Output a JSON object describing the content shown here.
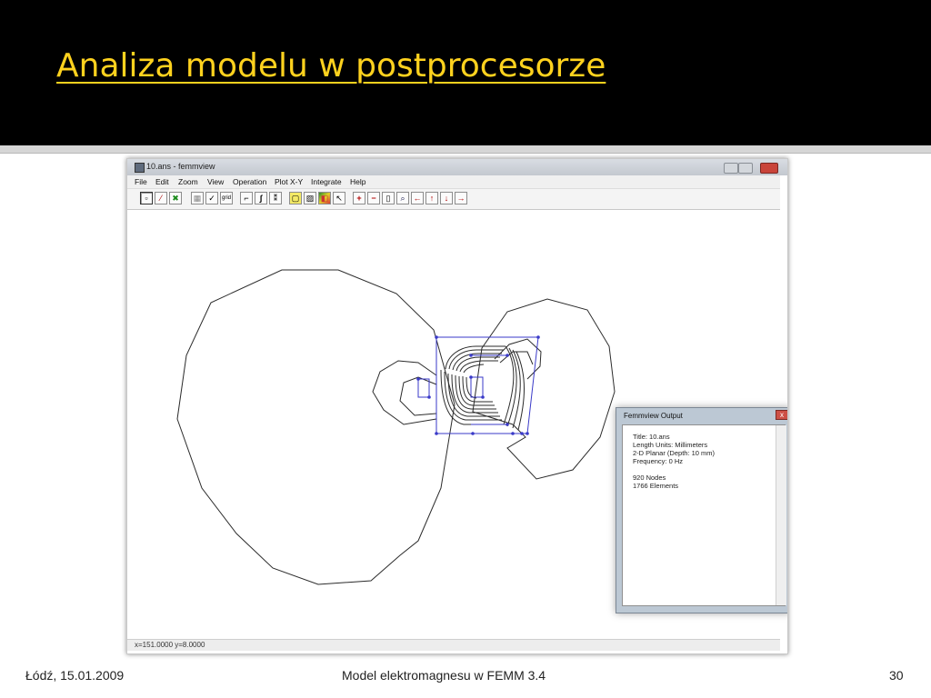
{
  "slide": {
    "title": "Analiza modelu w postprocesorze",
    "footer_left": "Łódź, 15.01.2009",
    "footer_center": "Model elektromagnesu w FEMM 3.4",
    "page_number": "30"
  },
  "app": {
    "window_title": "10.ans - femmview",
    "menu": [
      "File",
      "Edit",
      "Zoom",
      "View",
      "Operation",
      "Plot X-Y",
      "Integrate",
      "Help"
    ],
    "toolbar_glyphs": [
      "▫",
      "⁄",
      "✖",
      "▦",
      "✓",
      "grid",
      "⌐",
      "∫",
      "⁑",
      "▢",
      "▨",
      "◧",
      "↖",
      "+",
      "−",
      "▯",
      "⌕",
      "←",
      "↑",
      "↓",
      "→"
    ],
    "status_text": "x=151.0000 y=8.0000"
  },
  "output_window": {
    "title": "Femmview Output",
    "close_glyph": "x",
    "lines": [
      "Title: 10.ans",
      "Length Units: Millimeters",
      "2-D Planar (Depth: 10 mm)",
      "Frequency: 0 Hz",
      "",
      "920 Nodes",
      "1766 Elements"
    ]
  },
  "colors": {
    "header_bg": "#000000",
    "title_color": "#ffd21e",
    "contour_color": "#2b2b2b",
    "geometry_color": "#3a3ac8"
  }
}
